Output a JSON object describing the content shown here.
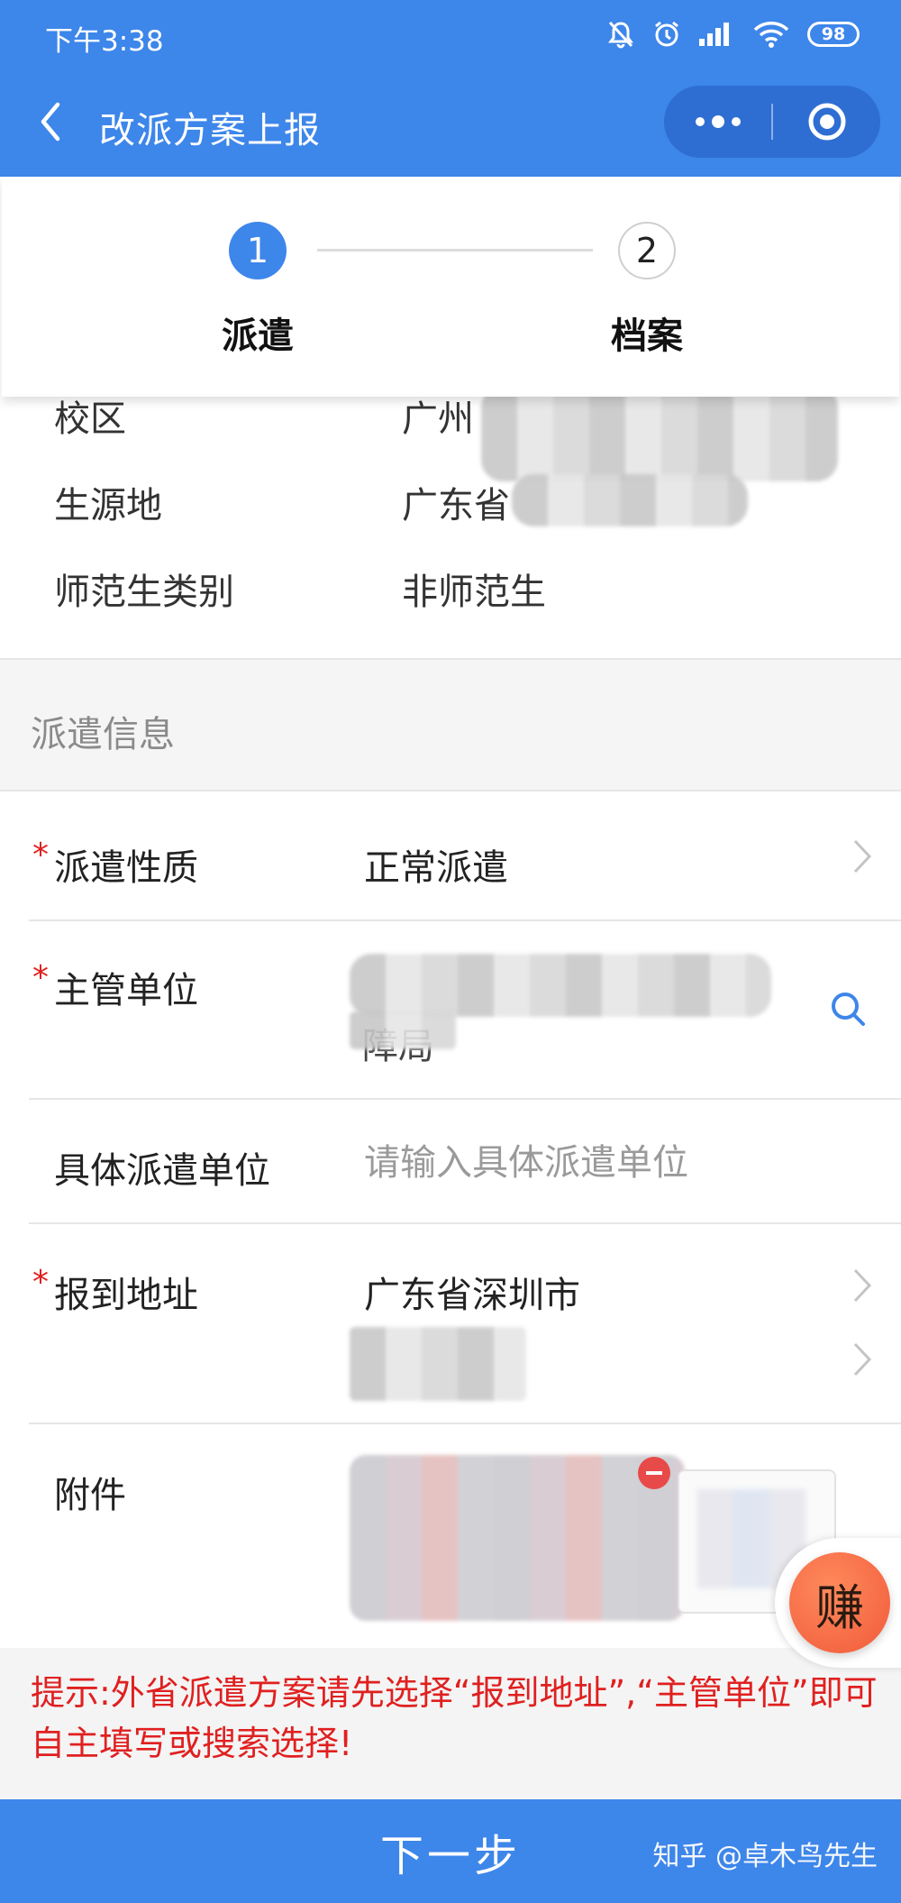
{
  "status_bar": {
    "time": "下午3:38",
    "battery": "98"
  },
  "nav": {
    "title": "改派方案上报"
  },
  "steps": [
    {
      "number": "1",
      "label": "派遣"
    },
    {
      "number": "2",
      "label": "档案"
    }
  ],
  "info": [
    {
      "label": "校区",
      "value": "广州"
    },
    {
      "label": "生源地",
      "value": "广东省"
    },
    {
      "label": "师范生类别",
      "value": "非师范生"
    }
  ],
  "section_title": "派遣信息",
  "form": {
    "dispatch_type": {
      "label": "派遣性质",
      "value": "正常派遣"
    },
    "authority": {
      "label": "主管单位",
      "value_tail": "障局"
    },
    "unit": {
      "label": "具体派遣单位",
      "placeholder": "请输入具体派遣单位"
    },
    "address": {
      "label": "报到地址",
      "value": "广东省深圳市"
    },
    "attachment": {
      "label": "附件"
    }
  },
  "floating_badge": "赚",
  "hint": "提示:外省派遣方案请先选择“报到地址”,“主管单位”即可自主填写或搜索选择!",
  "footer": {
    "next_label": "下一步",
    "watermark": "知乎 @卓木鸟先生"
  }
}
